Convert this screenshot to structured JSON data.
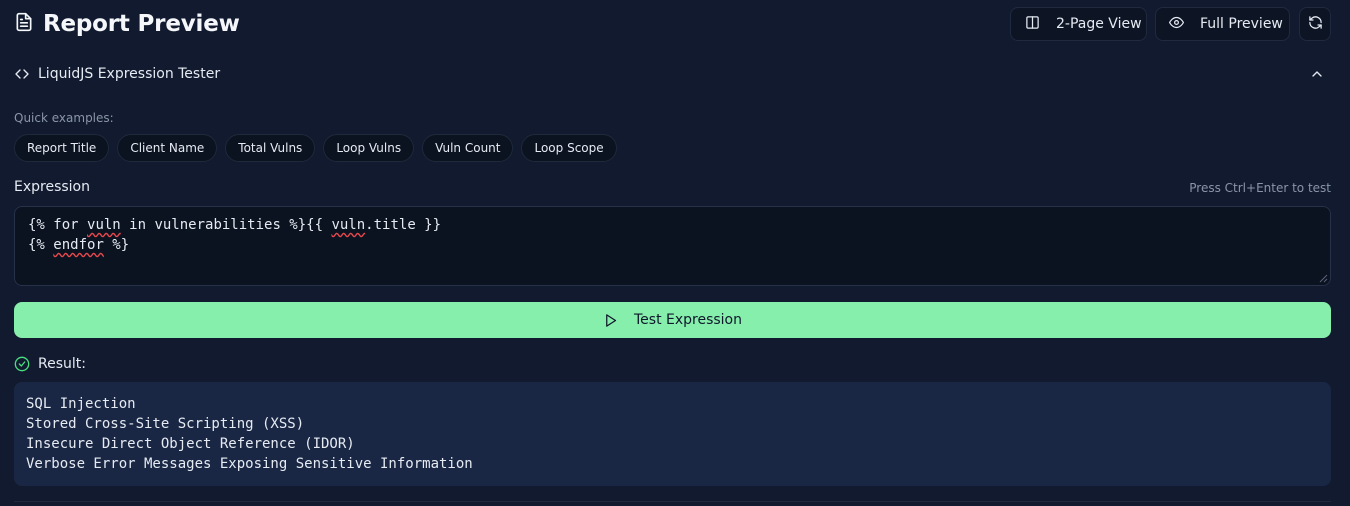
{
  "header": {
    "title": "Report Preview",
    "title_icon": "file-text-icon",
    "buttons": {
      "two_page": "2-Page View",
      "full_preview": "Full Preview"
    }
  },
  "tester": {
    "title": "LiquidJS Expression Tester",
    "quick_label": "Quick examples:",
    "examples": [
      "Report Title",
      "Client Name",
      "Total Vulns",
      "Loop Vulns",
      "Vuln Count",
      "Loop Scope"
    ],
    "expression_label": "Expression",
    "hint": "Press Ctrl+Enter to test",
    "expression": {
      "line1_a": "{% for ",
      "line1_b": "vuln",
      "line1_c": " in vulnerabilities %}{{ ",
      "line1_d": "vuln",
      "line1_e": ".title }}",
      "line2_a": "{% ",
      "line2_b": "endfor",
      "line2_c": " %}"
    },
    "test_button": "Test Expression",
    "result_label": "Result:",
    "result_lines": [
      "SQL Injection",
      "Stored Cross-Site Scripting (XSS)",
      "Insecure Direct Object Reference (IDOR)",
      "Verbose Error Messages Exposing Sensitive Information"
    ]
  },
  "colors": {
    "background": "#111a2e",
    "accent": "#86efac",
    "success": "#4ade80"
  }
}
